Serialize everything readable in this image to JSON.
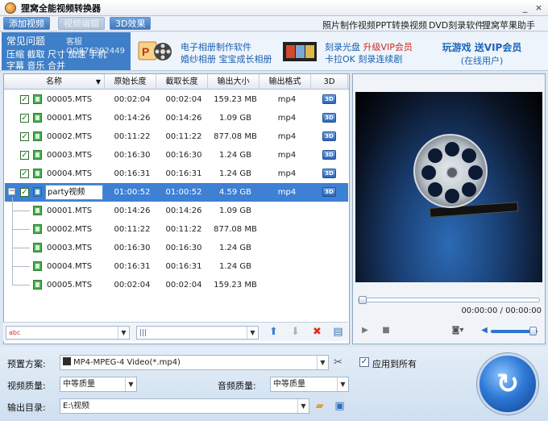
{
  "window": {
    "title": "狸窝全能视频转换器",
    "minimize": "_",
    "close": "×"
  },
  "menubar": {
    "tabs": [
      {
        "label": "添加视频",
        "state": "active"
      },
      {
        "label": "视频编辑",
        "state": "disabled"
      },
      {
        "label": "3D效果",
        "state": "normal"
      }
    ],
    "links": [
      "照片制作视频",
      "PPT转换视频",
      "DVD刻录软件",
      "狸窝苹果助手"
    ]
  },
  "banner": {
    "faq_title": "常见问题",
    "faq_qq": "客服QQ876292449",
    "faq_line1": "压缩 截取 尺寸 加速 手机",
    "faq_line2": "字幕 音乐 合并",
    "promo1_line1": "电子相册制作软件",
    "promo1_line2": "婚纱相册 宝宝成长相册",
    "promo2_line1a": "刻录光盘 ",
    "promo2_line1b": "升级VIP会员",
    "promo2_line2": "卡拉OK 刻录连续剧",
    "vip_title": "玩游戏 送VIP会员",
    "vip_sub": "(在线用户)"
  },
  "table": {
    "columns": [
      "名称",
      "原始长度",
      "截取长度",
      "输出大小",
      "输出格式",
      "3D"
    ],
    "rows": [
      {
        "name": "00005.MTS",
        "orig": "00:02:04",
        "cut": "00:02:04",
        "size": "159.23 MB",
        "fmt": "mp4",
        "level": 0,
        "checked": true
      },
      {
        "name": "00001.MTS",
        "orig": "00:14:26",
        "cut": "00:14:26",
        "size": "1.09 GB",
        "fmt": "mp4",
        "level": 0,
        "checked": true
      },
      {
        "name": "00002.MTS",
        "orig": "00:11:22",
        "cut": "00:11:22",
        "size": "877.08 MB",
        "fmt": "mp4",
        "level": 0,
        "checked": true
      },
      {
        "name": "00003.MTS",
        "orig": "00:16:30",
        "cut": "00:16:30",
        "size": "1.24 GB",
        "fmt": "mp4",
        "level": 0,
        "checked": true
      },
      {
        "name": "00004.MTS",
        "orig": "00:16:31",
        "cut": "00:16:31",
        "size": "1.24 GB",
        "fmt": "mp4",
        "level": 0,
        "checked": true
      },
      {
        "name": "party视频",
        "orig": "01:00:52",
        "cut": "01:00:52",
        "size": "4.59 GB",
        "fmt": "mp4",
        "level": 0,
        "checked": true,
        "group": true,
        "selected": true
      },
      {
        "name": "00001.MTS",
        "orig": "00:14:26",
        "cut": "00:14:26",
        "size": "1.09 GB",
        "fmt": "",
        "level": 1
      },
      {
        "name": "00002.MTS",
        "orig": "00:11:22",
        "cut": "00:11:22",
        "size": "877.08 MB",
        "fmt": "",
        "level": 1
      },
      {
        "name": "00003.MTS",
        "orig": "00:16:30",
        "cut": "00:16:30",
        "size": "1.24 GB",
        "fmt": "",
        "level": 1
      },
      {
        "name": "00004.MTS",
        "orig": "00:16:31",
        "cut": "00:16:31",
        "size": "1.24 GB",
        "fmt": "",
        "level": 1
      },
      {
        "name": "00005.MTS",
        "orig": "00:02:04",
        "cut": "00:02:04",
        "size": "159.23 MB",
        "fmt": "",
        "level": 1
      }
    ],
    "badge_3d": "3D"
  },
  "preview": {
    "timecode": "00:00:00 / 00:00:00",
    "progress": 0,
    "volume": 0.9
  },
  "settings": {
    "preset_label": "预置方案:",
    "preset_value": "MP4-MPEG-4 Video(*.mp4)",
    "apply_all_label": "应用到所有",
    "video_quality_label": "视频质量:",
    "video_quality_value": "中等质量",
    "audio_quality_label": "音频质量:",
    "audio_quality_value": "中等质量",
    "output_dir_label": "输出目录:",
    "output_dir_value": "E:\\视频"
  },
  "colors": {
    "accent": "#3f7fc8",
    "selection": "#3d80d4",
    "vip_red": "#d0281f"
  }
}
